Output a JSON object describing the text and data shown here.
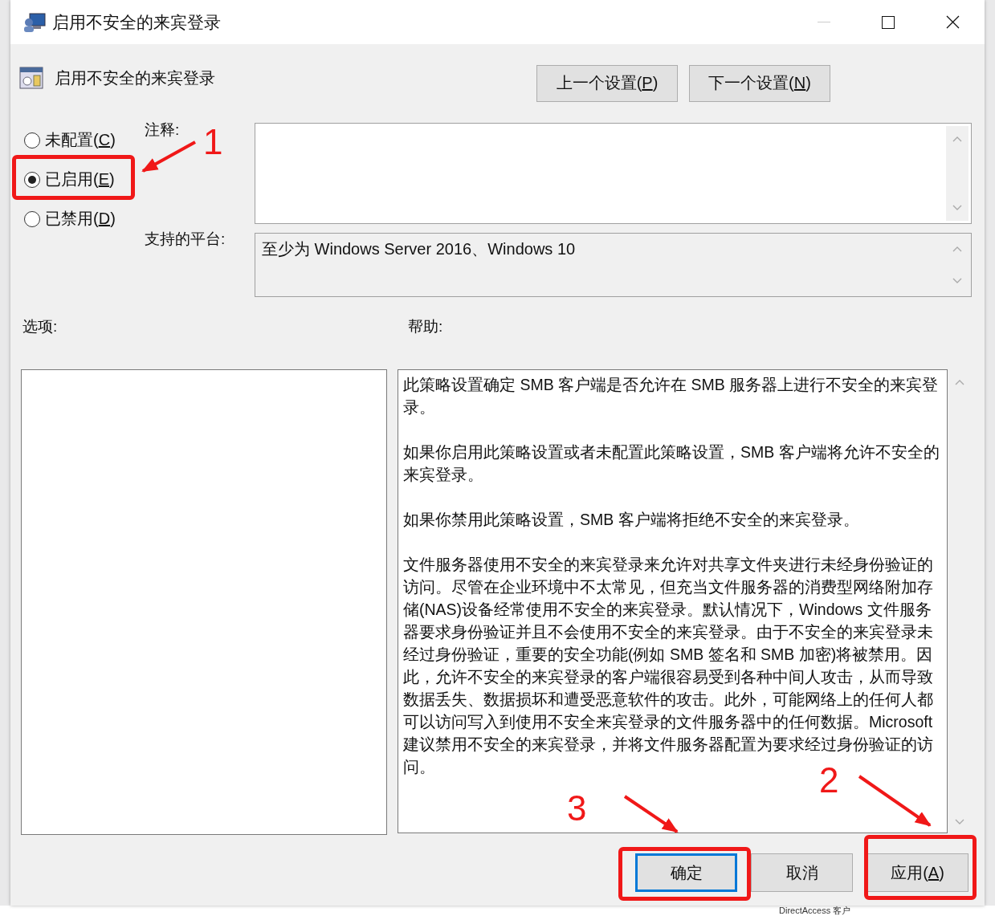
{
  "window": {
    "title": "启用不安全的来宾登录"
  },
  "header": {
    "title": "启用不安全的来宾登录"
  },
  "nav_buttons": [
    {
      "label": "上一个设置(",
      "key": "P",
      "suffix": ")"
    },
    {
      "label": "下一个设置(",
      "key": "N",
      "suffix": ")"
    }
  ],
  "state_options": [
    {
      "label": "未配置(",
      "key": "C",
      "suffix": ")",
      "selected": false
    },
    {
      "label": "已启用(",
      "key": "E",
      "suffix": ")",
      "selected": true
    },
    {
      "label": "已禁用(",
      "key": "D",
      "suffix": ")",
      "selected": false
    }
  ],
  "comment": {
    "label": "注释:"
  },
  "platform": {
    "label": "支持的平台:",
    "value": "至少为 Windows Server 2016、Windows 10"
  },
  "options": {
    "label": "选项:"
  },
  "help": {
    "label": "帮助:",
    "paragraphs": [
      "此策略设置确定 SMB 客户端是否允许在 SMB 服务器上进行不安全的来宾登录。",
      "如果你启用此策略设置或者未配置此策略设置，SMB 客户端将允许不安全的来宾登录。",
      "如果你禁用此策略设置，SMB 客户端将拒绝不安全的来宾登录。",
      "文件服务器使用不安全的来宾登录来允许对共享文件夹进行未经身份验证的访问。尽管在企业环境中不太常见，但充当文件服务器的消费型网络附加存储(NAS)设备经常使用不安全的来宾登录。默认情况下，Windows 文件服务器要求身份验证并且不会使用不安全的来宾登录。由于不安全的来宾登录未经过身份验证，重要的安全功能(例如 SMB 签名和 SMB 加密)将被禁用。因此，允许不安全的来宾登录的客户端很容易受到各种中间人攻击，从而导致数据丢失、数据损坏和遭受恶意软件的攻击。此外，可能网络上的任何人都可以访问写入到使用不安全来宾登录的文件服务器中的任何数据。Microsoft 建议禁用不安全的来宾登录，并将文件服务器配置为要求经过身份验证的访问。"
    ]
  },
  "buttons": [
    {
      "label": "确定",
      "default": true
    },
    {
      "label": "取消",
      "default": false
    },
    {
      "label": "应用(",
      "key": "A",
      "suffix": ")",
      "default": false
    }
  ],
  "annotations": [
    {
      "number": "1"
    },
    {
      "number": "2"
    },
    {
      "number": "3"
    }
  ],
  "background": {
    "item": "DirectAccess 客户"
  }
}
